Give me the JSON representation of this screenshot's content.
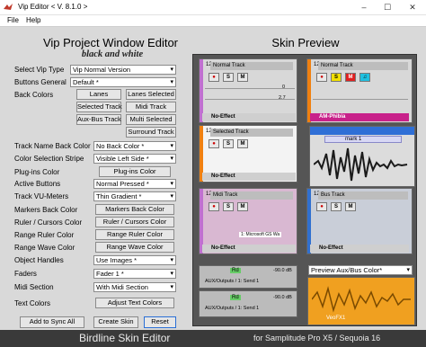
{
  "window": {
    "title": "Vip Editor  < V. 8.1.0 >",
    "min": "–",
    "max": "☐",
    "close": "✕"
  },
  "menu": [
    "File",
    "Help"
  ],
  "heading": {
    "title": "Vip Project Window Editor",
    "subtitle": "black and white",
    "preview_title": "Skin Preview"
  },
  "form": {
    "select_vip_type": {
      "label": "Select Vip Type",
      "value": "Vip Normal Version"
    },
    "buttons_general": {
      "label": "Buttons General",
      "value": "Default *"
    },
    "back_colors": {
      "label": "Back Colors",
      "buttons": [
        "Lanes",
        "Lanes Selected",
        "Selected Track",
        "Midi Track",
        "Aux-Bus Track",
        "Multi Selected",
        "Surround Track"
      ]
    },
    "track_name_back_color": {
      "label": "Track Name Back Color",
      "value": "No Back Color *"
    },
    "color_selection_stripe": {
      "label": "Color Selection Stripe",
      "value": "Visible Left Side *"
    },
    "plugin_color": {
      "label": "Plug-ins Color",
      "button": "Plug-ins Color"
    },
    "active_buttons": {
      "label": "Active Buttons",
      "value": "Normal Pressed *"
    },
    "track_vu_meters": {
      "label": "Track VU-Meters",
      "value": "Thin Gradient *"
    },
    "markers_back_color": {
      "label": "Markers Back Color",
      "button": "Markers Back Color"
    },
    "ruler_cursors_color": {
      "label": "Ruler / Cursors Color",
      "button": "Ruler / Cursors Color"
    },
    "range_ruler_color": {
      "label": "Range Ruler Color",
      "button": "Range Ruler Color"
    },
    "range_wave_color": {
      "label": "Range Wave Color",
      "button": "Range Wave Color"
    },
    "object_handles": {
      "label": "Object Handles",
      "value": "Use Images *"
    },
    "faders": {
      "label": "Faders",
      "value": "Fader 1 *"
    },
    "midi_section": {
      "label": "Midi Section",
      "value": "With Midi Section"
    },
    "text_colors": {
      "label": "Text Colors",
      "button": "Adjust Text Colors"
    }
  },
  "actions": {
    "add_to_sync": "Add to Sync All",
    "create_skin": "Create Skin",
    "reset": "Reset"
  },
  "footer": {
    "left": "Birdline Skin Editor",
    "right": "for Samplitude Pro X5 / Sequoia 16"
  },
  "preview": {
    "tracks": [
      {
        "num": "12",
        "name": "Normal Track",
        "effect": "No-Effect",
        "vol": "0",
        "pan": "2.7"
      },
      {
        "num": "12",
        "name": "Normal Track",
        "effect": "AM-Phibia"
      },
      {
        "num": "12",
        "name": "Selected Track",
        "effect": "No-Effect"
      },
      {
        "num": "12",
        "name": "Midi Track",
        "effect": "No-Effect",
        "midi_port": "1: Microsoft GS Wa"
      },
      {
        "num": "12",
        "name": "Bus Track",
        "effect": "No-Effect"
      }
    ],
    "marker": "mark 1",
    "rd_rows": [
      {
        "label": "Rd",
        "value": "-90.0 dB",
        "sub": "AUX/Outputs /  1: Send 1"
      },
      {
        "label": "Rd",
        "value": "-90.0 dB",
        "sub": "AUX/Outputs /  1: Send 1"
      }
    ],
    "aux_combo": "Preview Aux/Bus Color*",
    "orange_label": "VeoFX1",
    "colors": {
      "purple_stripe": "#c070d0",
      "orange_stripe": "#f08010",
      "blue_stripe": "#3070d0",
      "magenta_effect": "#c8218a",
      "orange_region": "#f0a020"
    }
  }
}
